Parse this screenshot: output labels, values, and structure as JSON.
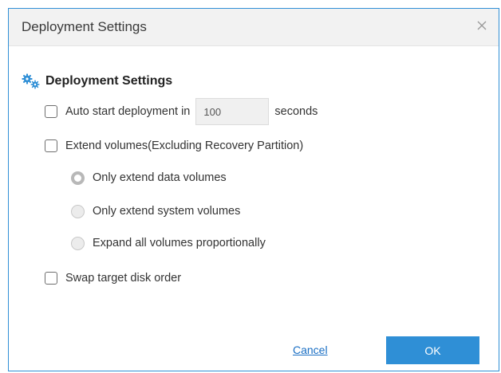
{
  "dialog": {
    "title": "Deployment Settings",
    "close_icon": "close-icon"
  },
  "section": {
    "icon": "gears-icon",
    "title": "Deployment Settings",
    "accent_color": "#2f8fd6"
  },
  "options": {
    "auto_start": {
      "checked": false,
      "label_before": "Auto start deployment in",
      "seconds_value": "100",
      "label_after": "seconds"
    },
    "extend_volumes": {
      "checked": false,
      "label": "Extend volumes(Excluding Recovery Partition)"
    },
    "extend_modes": [
      {
        "label": "Only extend data volumes",
        "selected": true
      },
      {
        "label": "Only extend system volumes",
        "selected": false
      },
      {
        "label": "Expand all volumes proportionally",
        "selected": false
      }
    ],
    "swap_disk_order": {
      "checked": false,
      "label": "Swap target disk order"
    }
  },
  "buttons": {
    "cancel": "Cancel",
    "ok": "OK"
  }
}
